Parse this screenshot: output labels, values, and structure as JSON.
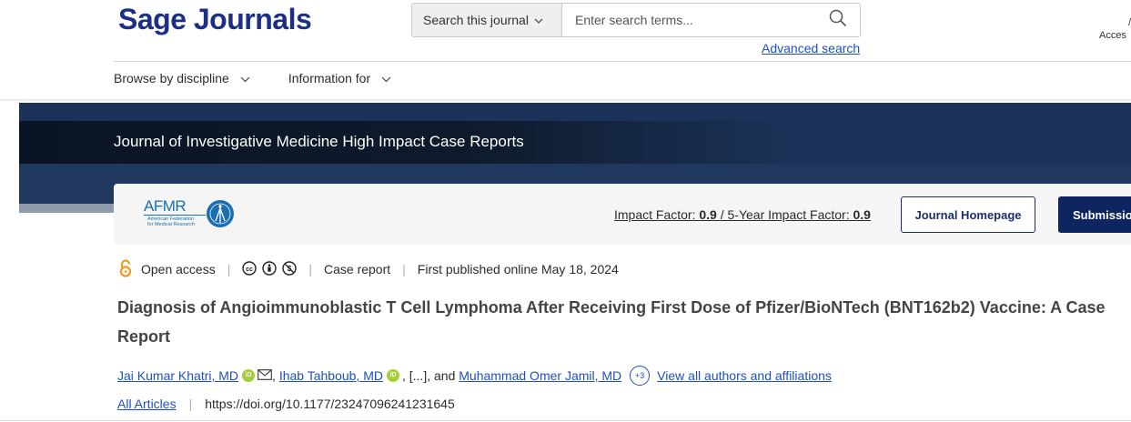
{
  "header": {
    "brand": "Sage Journals",
    "search_scope_label": "Search this journal",
    "search_placeholder": "Enter search terms...",
    "advanced_search": "Advanced search",
    "access_text_line1": "/",
    "access_text_line2": "Acces"
  },
  "nav": {
    "items": [
      {
        "label": "Browse by discipline"
      },
      {
        "label": "Information for"
      }
    ]
  },
  "banner": {
    "journal_title": "Journal of Investigative Medicine High Impact Case Reports"
  },
  "journal_card": {
    "logo_text": "AFMR",
    "logo_subtext_line1": "American Federation",
    "logo_subtext_line2": "for Medical Research",
    "impact_factor_label": "Impact Factor:",
    "impact_factor_value": "0.9",
    "five_year_label": "5-Year Impact Factor:",
    "five_year_value": "0.9",
    "homepage_button": "Journal Homepage",
    "submission_button": "Submission"
  },
  "article": {
    "access_label": "Open access",
    "license_icons": [
      "cc-icon",
      "by-icon",
      "nc-icon"
    ],
    "article_type": "Case report",
    "published": "First published online May 18, 2024",
    "title": "Diagnosis of Angioimmunoblastic T Cell Lymphoma After Receiving First Dose of Pfizer/BioNTech (BNT162b2) Vaccine: A Case Report",
    "authors": [
      {
        "name": "Jai Kumar Khatri, MD"
      },
      {
        "name": "Ihab Tahboub, MD"
      },
      {
        "name": "Muhammad Omer Jamil, MD"
      }
    ],
    "ellipsis": ", [...], and ",
    "more_count": "+3",
    "view_all": "View all authors and affiliations",
    "all_articles": "All Articles",
    "doi": "https://doi.org/10.1177/23247096241231645"
  },
  "colors": {
    "brand_navy": "#1b2f86",
    "link_blue": "#1f4fbf",
    "banner_dark": "#0b1424",
    "banner_navy": "#1b3358",
    "submission_bg": "#0e2561",
    "orcid_green": "#a6ce39",
    "open_access_orange": "#f39a1e"
  }
}
